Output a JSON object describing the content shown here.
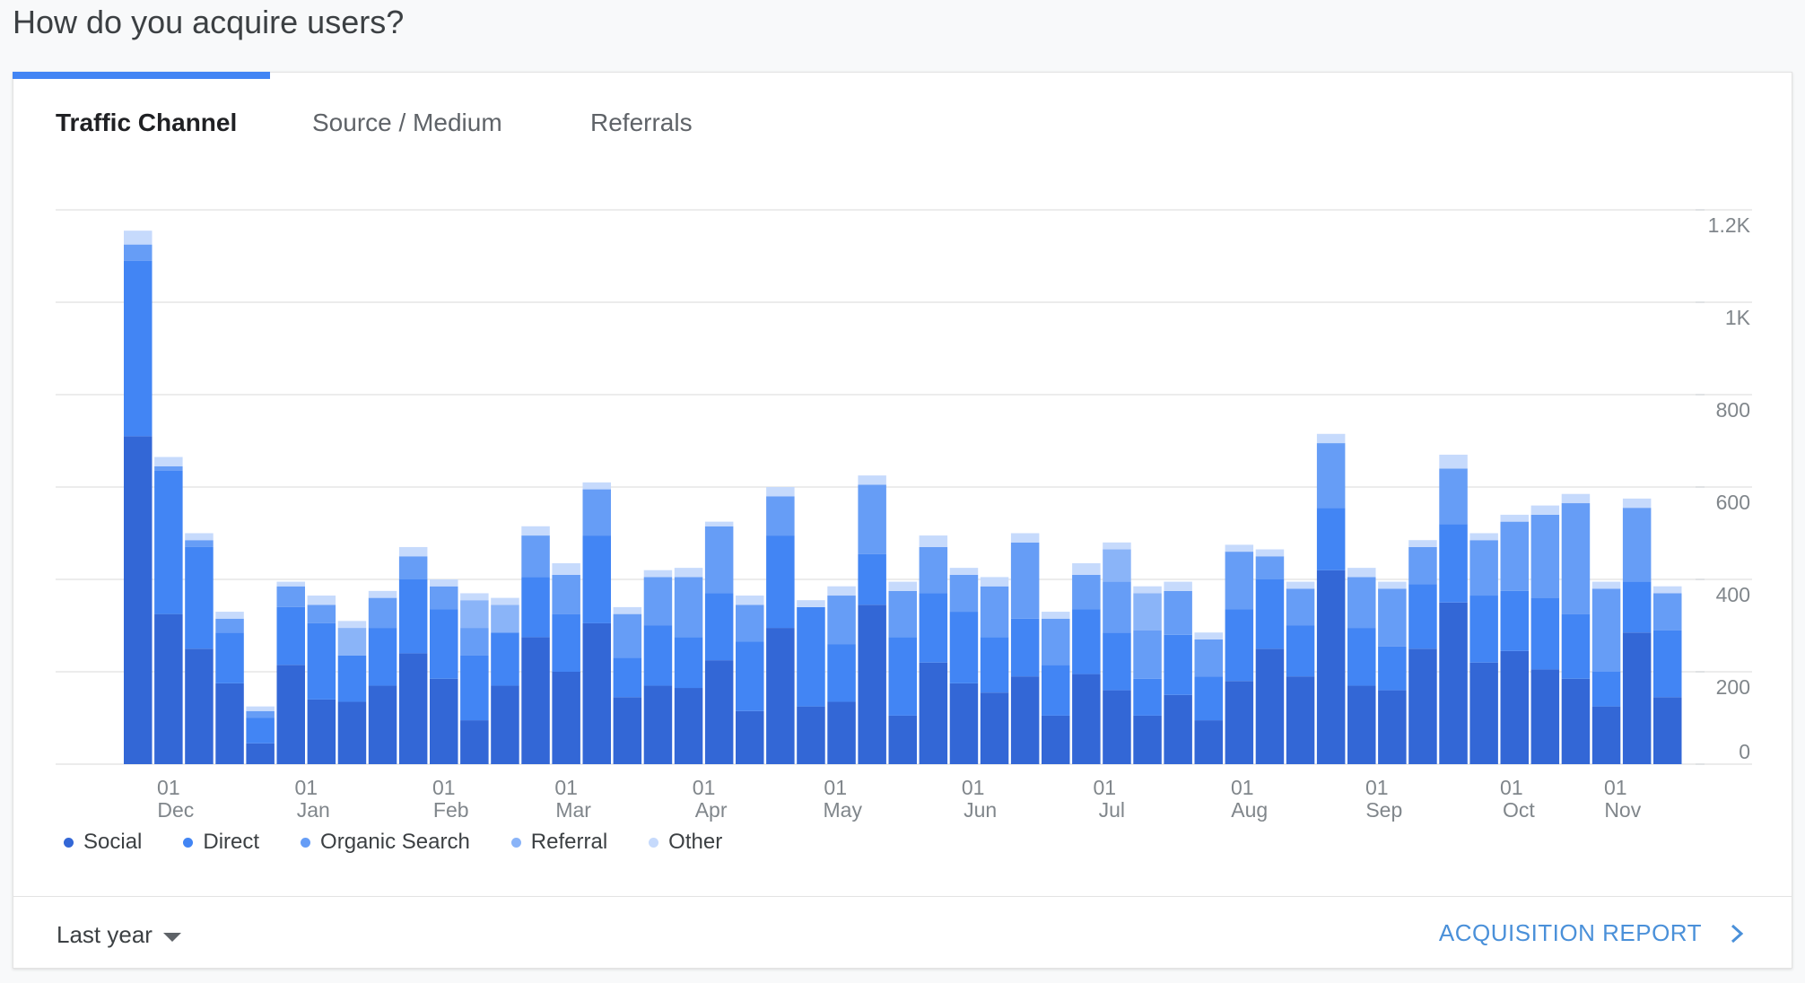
{
  "page": {
    "title": "How do you acquire users?"
  },
  "tabs": [
    {
      "label": "Traffic Channel",
      "active": true
    },
    {
      "label": "Source / Medium",
      "active": false
    },
    {
      "label": "Referrals",
      "active": false
    }
  ],
  "footer": {
    "range_label": "Last year",
    "report_link": "ACQUISITION REPORT"
  },
  "icons": {
    "range_caret": "caret-down-icon",
    "report_chevron": "chevron-right-icon"
  },
  "colors": {
    "accent": "#4285f4",
    "social": "#3367d6",
    "direct": "#4285f4",
    "organic_search": "#669df6",
    "referral": "#8ab4f8",
    "other": "#c6dafc"
  },
  "chart_data": {
    "type": "bar",
    "stacked": true,
    "y_axis_position": "right",
    "ylim": [
      0,
      1200
    ],
    "y_ticks": [
      "0",
      "200",
      "400",
      "600",
      "800",
      "1K",
      "1.2K"
    ],
    "y_tick_values": [
      0,
      200,
      400,
      600,
      800,
      1000,
      1200
    ],
    "grid": true,
    "legend_position": "bottom-left",
    "x_tick_labels": [
      {
        "day": "01",
        "month": "Dec",
        "bar_index": 1
      },
      {
        "day": "01",
        "month": "Jan",
        "bar_index": 5.5
      },
      {
        "day": "01",
        "month": "Feb",
        "bar_index": 10
      },
      {
        "day": "01",
        "month": "Mar",
        "bar_index": 14
      },
      {
        "day": "01",
        "month": "Apr",
        "bar_index": 18.5
      },
      {
        "day": "01",
        "month": "May",
        "bar_index": 22.8
      },
      {
        "day": "01",
        "month": "Jun",
        "bar_index": 27.3
      },
      {
        "day": "01",
        "month": "Jul",
        "bar_index": 31.6
      },
      {
        "day": "01",
        "month": "Aug",
        "bar_index": 36.1
      },
      {
        "day": "01",
        "month": "Sep",
        "bar_index": 40.5
      },
      {
        "day": "01",
        "month": "Oct",
        "bar_index": 44.9
      },
      {
        "day": "01",
        "month": "Nov",
        "bar_index": 48.3
      }
    ],
    "series": [
      {
        "name": "Social",
        "color": "#3367d6",
        "values": [
          710,
          325,
          250,
          175,
          45,
          215,
          140,
          135,
          170,
          240,
          185,
          95,
          170,
          275,
          200,
          305,
          145,
          170,
          165,
          225,
          115,
          295,
          125,
          135,
          345,
          105,
          220,
          175,
          155,
          190,
          105,
          195,
          160,
          105,
          150,
          95,
          180,
          250,
          190,
          420,
          170,
          160,
          250,
          350,
          220,
          245,
          205,
          185,
          125,
          285,
          145
        ]
      },
      {
        "name": "Direct",
        "color": "#4285f4",
        "values": [
          380,
          310,
          220,
          110,
          55,
          125,
          165,
          100,
          125,
          160,
          150,
          140,
          115,
          130,
          125,
          190,
          85,
          130,
          110,
          145,
          150,
          200,
          215,
          125,
          110,
          170,
          150,
          155,
          120,
          125,
          110,
          140,
          125,
          80,
          130,
          95,
          155,
          150,
          110,
          135,
          125,
          95,
          140,
          170,
          145,
          130,
          155,
          140,
          75,
          110,
          145
        ]
      },
      {
        "name": "Organic Search",
        "color": "#669df6",
        "values": [
          35,
          10,
          15,
          30,
          15,
          45,
          40,
          0,
          65,
          50,
          50,
          60,
          0,
          90,
          85,
          100,
          95,
          105,
          130,
          145,
          80,
          85,
          0,
          105,
          150,
          100,
          100,
          80,
          110,
          165,
          100,
          75,
          110,
          105,
          95,
          80,
          125,
          50,
          80,
          140,
          110,
          125,
          80,
          120,
          120,
          150,
          180,
          240,
          180,
          160,
          80
        ]
      },
      {
        "name": "Referral",
        "color": "#8ab4f8",
        "values": [
          0,
          0,
          0,
          0,
          0,
          0,
          0,
          60,
          0,
          0,
          0,
          60,
          60,
          0,
          0,
          0,
          0,
          0,
          0,
          0,
          0,
          0,
          0,
          0,
          0,
          0,
          0,
          0,
          0,
          0,
          0,
          0,
          70,
          80,
          0,
          0,
          0,
          0,
          0,
          0,
          0,
          0,
          0,
          0,
          0,
          0,
          0,
          0,
          0,
          0,
          0
        ]
      },
      {
        "name": "Other",
        "color": "#c6dafc",
        "values": [
          30,
          20,
          15,
          15,
          10,
          10,
          20,
          15,
          15,
          20,
          15,
          15,
          15,
          20,
          25,
          15,
          15,
          15,
          20,
          10,
          20,
          20,
          15,
          20,
          20,
          20,
          25,
          15,
          20,
          20,
          15,
          25,
          15,
          15,
          20,
          15,
          15,
          15,
          15,
          20,
          20,
          15,
          15,
          30,
          15,
          15,
          20,
          20,
          15,
          20,
          15
        ]
      }
    ]
  }
}
